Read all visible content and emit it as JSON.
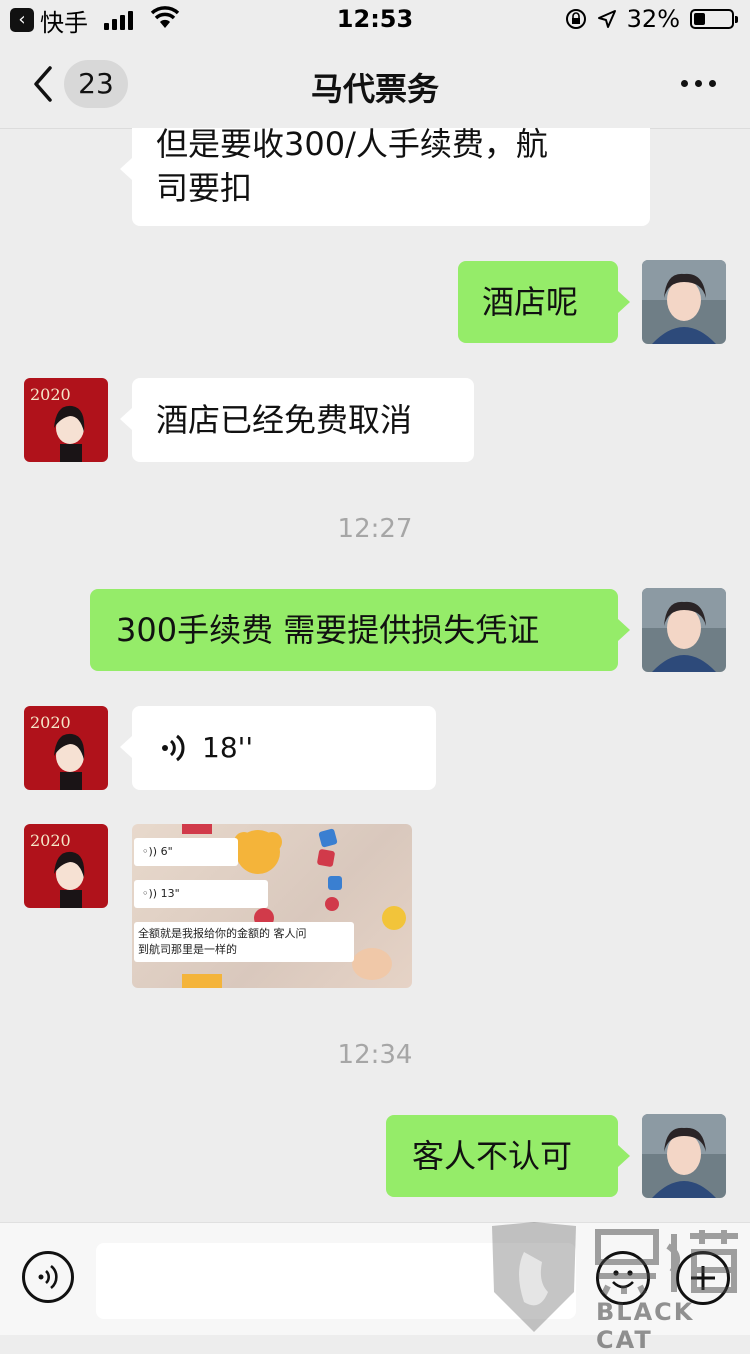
{
  "status_bar": {
    "back_app": "快手",
    "time": "12:53",
    "battery": "32%"
  },
  "nav": {
    "unread_count": "23",
    "title": "马代票务"
  },
  "messages": [
    {
      "side": "left",
      "text_line1": "但是要收300/人手续费，航",
      "text_line2": "司要扣"
    },
    {
      "side": "right",
      "text": "酒店呢"
    },
    {
      "side": "left",
      "text": "酒店已经免费取消"
    },
    {
      "timestamp": "12:27"
    },
    {
      "side": "right",
      "text": "300手续费 需要提供损失凭证"
    },
    {
      "side": "left",
      "voice_duration": "18''"
    },
    {
      "side": "left",
      "image": {
        "voice1": "6\"",
        "voice2": "13\"",
        "caption_line1": "全额就是我报给你的金额的 客人问",
        "caption_line2": "到航司那里是一样的"
      }
    },
    {
      "timestamp": "12:34"
    },
    {
      "side": "right",
      "text": "客人不认可"
    }
  ],
  "avatar_left_text": "2020",
  "watermark": "BLACK CAT",
  "colors": {
    "sent_bubble": "#95ec69",
    "received_bubble": "#ffffff",
    "background": "#ededed"
  }
}
